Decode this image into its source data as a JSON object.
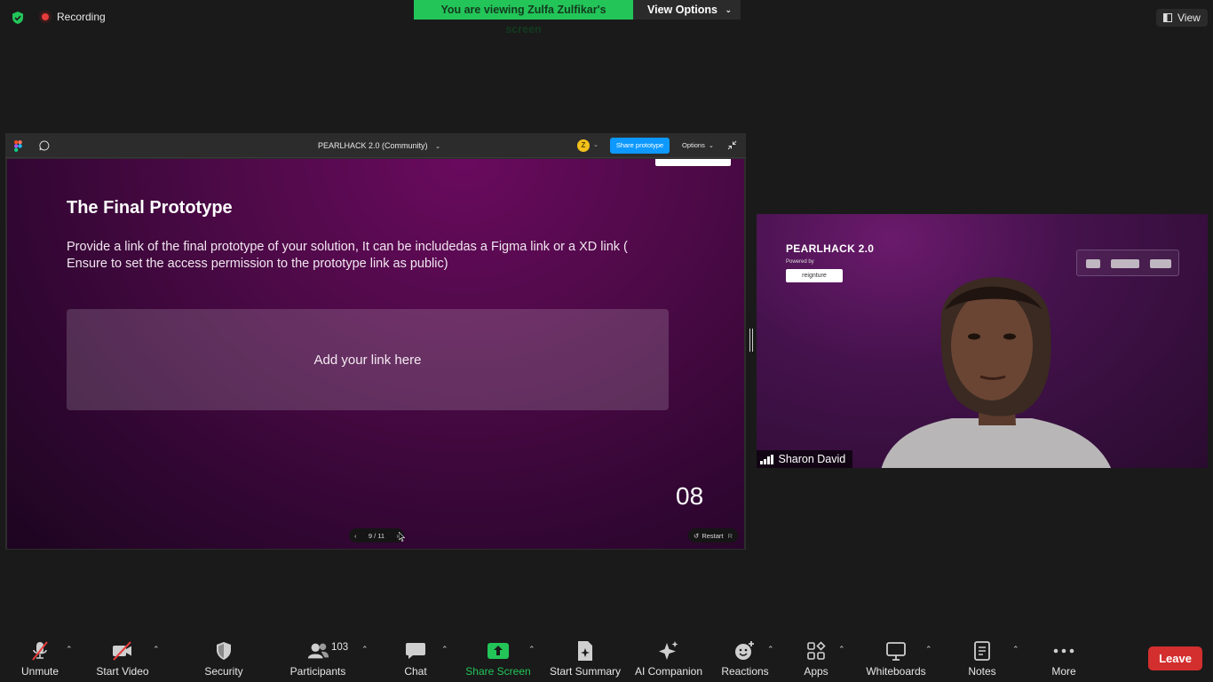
{
  "top": {
    "recording_label": "Recording",
    "viewing_banner": "You are viewing Zulfa Zulfikar's screen",
    "view_options_label": "View Options",
    "view_label": "View"
  },
  "figma": {
    "file_title": "PEARLHACK 2.0 (Community)",
    "avatar_initial": "Z",
    "share_button": "Share prototype",
    "options_label": "Options"
  },
  "slide": {
    "title": "The Final Prototype",
    "body": "Provide a link of the final prototype of your solution, It can be includedas a Figma link or a XD link  ( Ensure to set the access permission to the prototype link as public)",
    "link_placeholder": "Add your link here",
    "number": "08",
    "pager": "9 / 11",
    "restart_label": "Restart",
    "restart_key": "R"
  },
  "video": {
    "brand": "PEARLHACK 2.0",
    "powered_by": "Powered by",
    "sponsor_logo": "reignture",
    "participant_name": "Sharon David"
  },
  "toolbar": {
    "unmute": "Unmute",
    "start_video": "Start Video",
    "security": "Security",
    "participants": "Participants",
    "participants_count": "103",
    "chat": "Chat",
    "share_screen": "Share Screen",
    "start_summary": "Start Summary",
    "ai_companion": "AI Companion",
    "reactions": "Reactions",
    "apps": "Apps",
    "whiteboards": "Whiteboards",
    "notes": "Notes",
    "more": "More",
    "leave": "Leave"
  },
  "colors": {
    "accent_green": "#23c559",
    "leave_red": "#d32f2f",
    "figma_blue": "#0d99ff"
  }
}
